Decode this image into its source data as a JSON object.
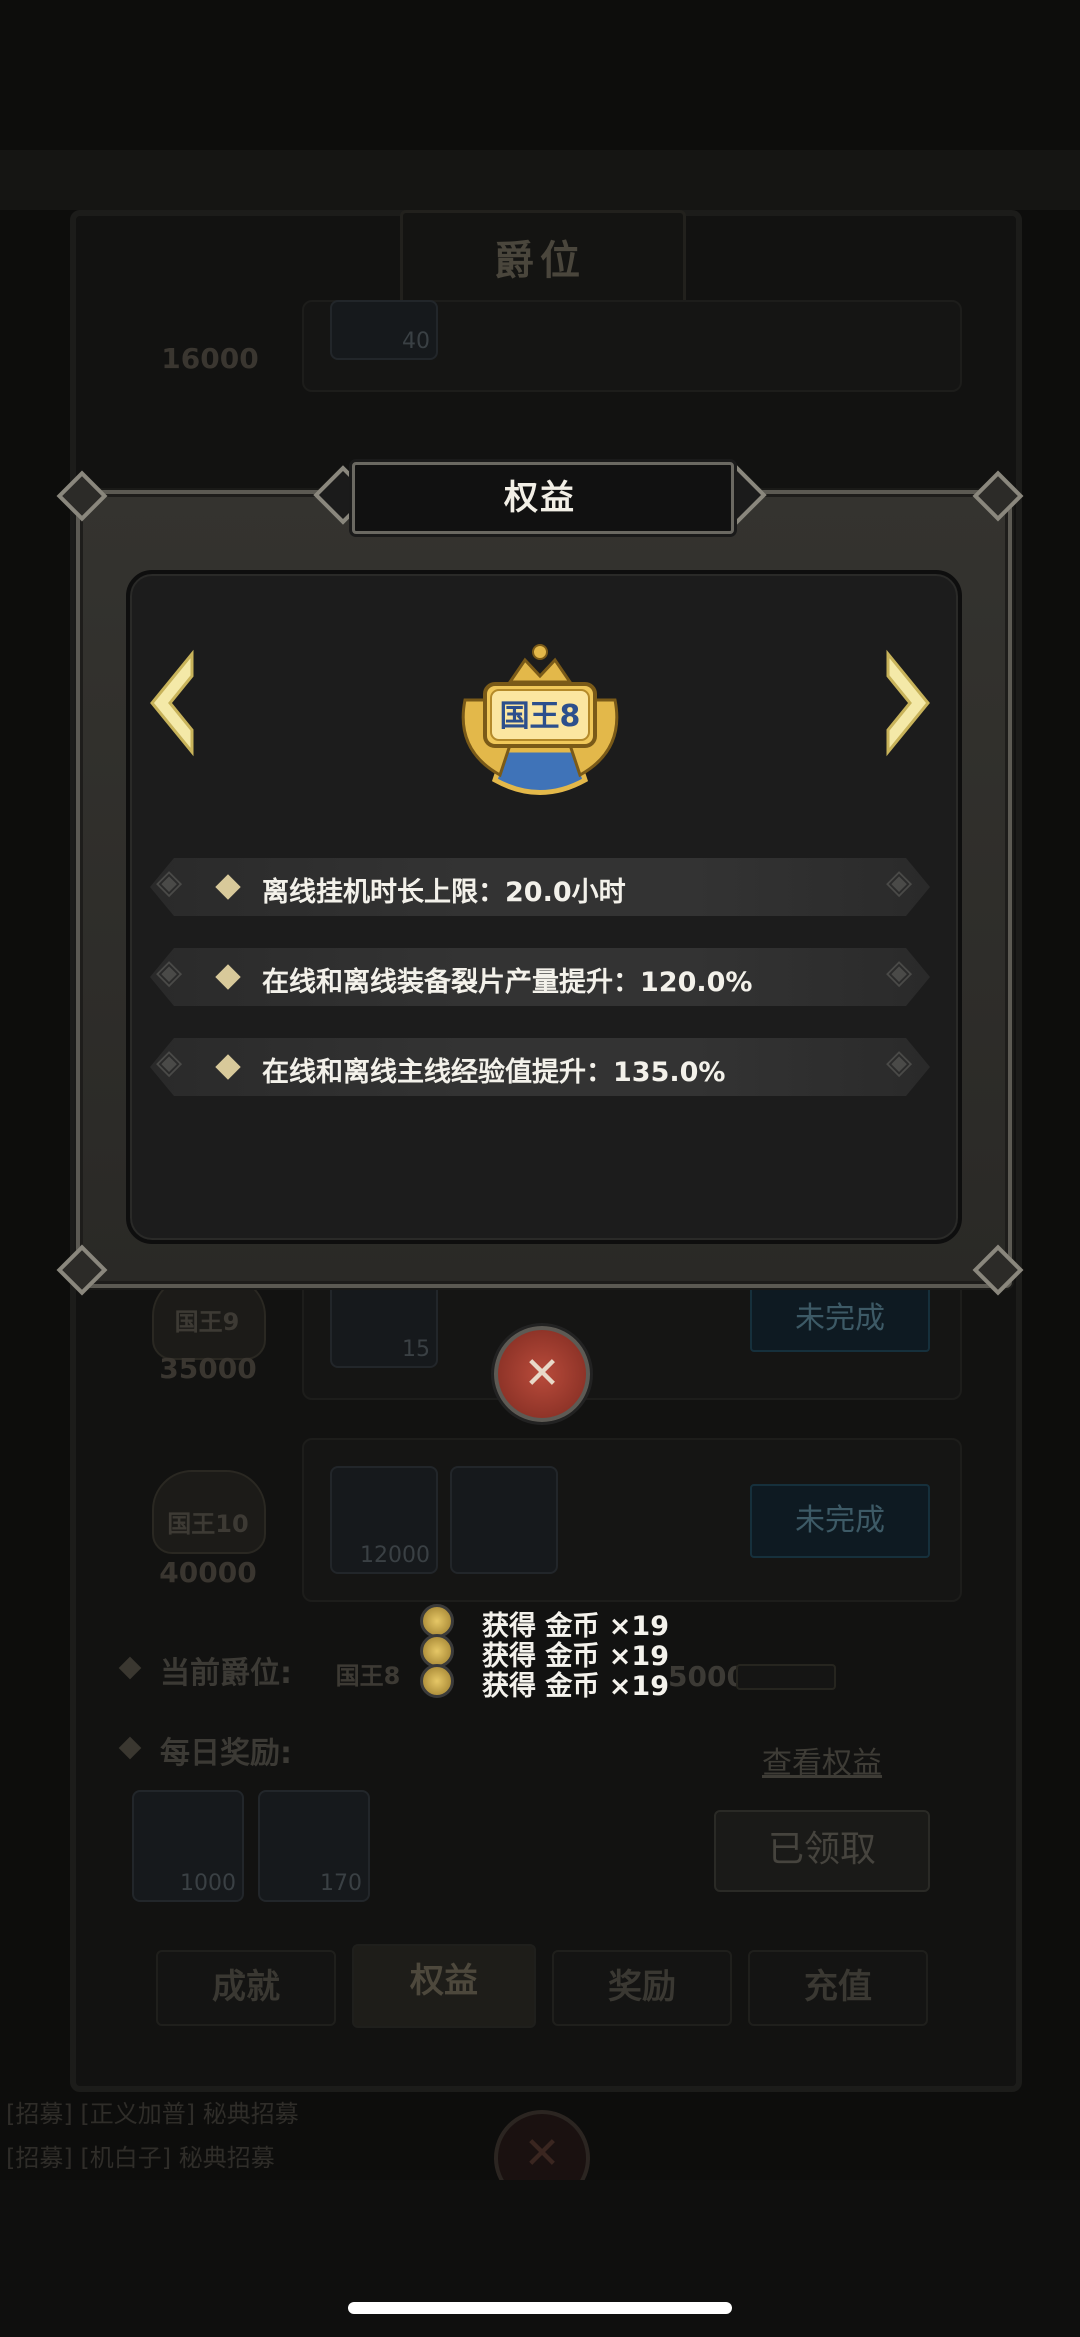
{
  "background": {
    "title": "爵位",
    "rows": [
      {
        "score": "16000",
        "item_counts": [
          "40"
        ]
      },
      {
        "badge": "国王9",
        "score": "35000",
        "item_counts": [
          "15"
        ],
        "status": "未完成"
      },
      {
        "badge": "国王10",
        "score": "40000",
        "item_counts": [
          "12000"
        ],
        "status": "未完成"
      }
    ],
    "current_rank_label": "当前爵位:",
    "current_rank_badge": "国王8",
    "current_rank_progress": "5000",
    "daily_reward_label": "每日奖励:",
    "view_benefits_link": "查看权益",
    "daily_items": [
      "1000",
      "170"
    ],
    "claimed_button": "已领取",
    "tabs": [
      "成就",
      "权益",
      "奖励",
      "充值"
    ],
    "active_tab": "权益",
    "chat_lines": [
      "[招募] [正义加普] 秘典招募",
      "[招募] [机白子] 秘典招募"
    ]
  },
  "modal": {
    "title": "权益",
    "emblem_label": "国王8",
    "benefits": [
      "离线挂机时长上限：20.0小时",
      "在线和离线装备裂片产量提升：120.0%",
      "在线和离线主线经验值提升：135.0%"
    ],
    "prev_icon": "chevron-left-icon",
    "next_icon": "chevron-right-icon",
    "close_icon": "close-x-icon"
  },
  "toasts": [
    "获得 金币 ×19",
    "获得 金币 ×19",
    "获得 金币 ×19"
  ],
  "colors": {
    "modal_frame": "#5c5a53",
    "benefit_bullet": "#d8c99a",
    "close_button": "#b94b3b",
    "emblem_gold": "#e3b84a",
    "emblem_blue": "#3f73b8"
  }
}
